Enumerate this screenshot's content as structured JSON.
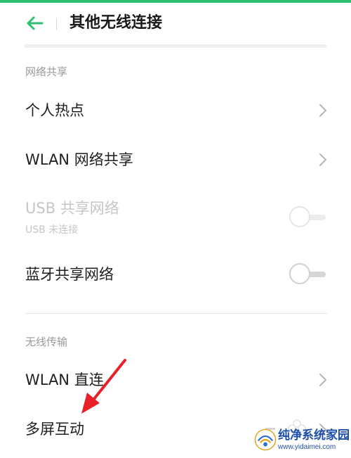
{
  "header": {
    "title": "其他无线连接",
    "back_icon": "arrow-left-icon",
    "accent_color": "#2fbf71"
  },
  "sections": [
    {
      "title": "网络共享",
      "items": [
        {
          "label": "个人热点",
          "control": "chevron"
        },
        {
          "label": "WLAN 网络共享",
          "control": "chevron"
        },
        {
          "label": "USB 共享网络",
          "subtitle": "USB 未连接",
          "control": "toggle",
          "enabled": false,
          "on": false
        },
        {
          "label": "蓝牙共享网络",
          "control": "toggle",
          "enabled": true,
          "on": false
        }
      ]
    },
    {
      "title": "无线传输",
      "items": [
        {
          "label": "WLAN 直连",
          "control": "chevron"
        },
        {
          "label": "多屏互动",
          "control": "chevron"
        }
      ]
    }
  ],
  "annotation": {
    "arrow_color": "#e8202a"
  },
  "watermark": {
    "name": "纯净系统家园",
    "url": "www.yidaimei.com"
  }
}
